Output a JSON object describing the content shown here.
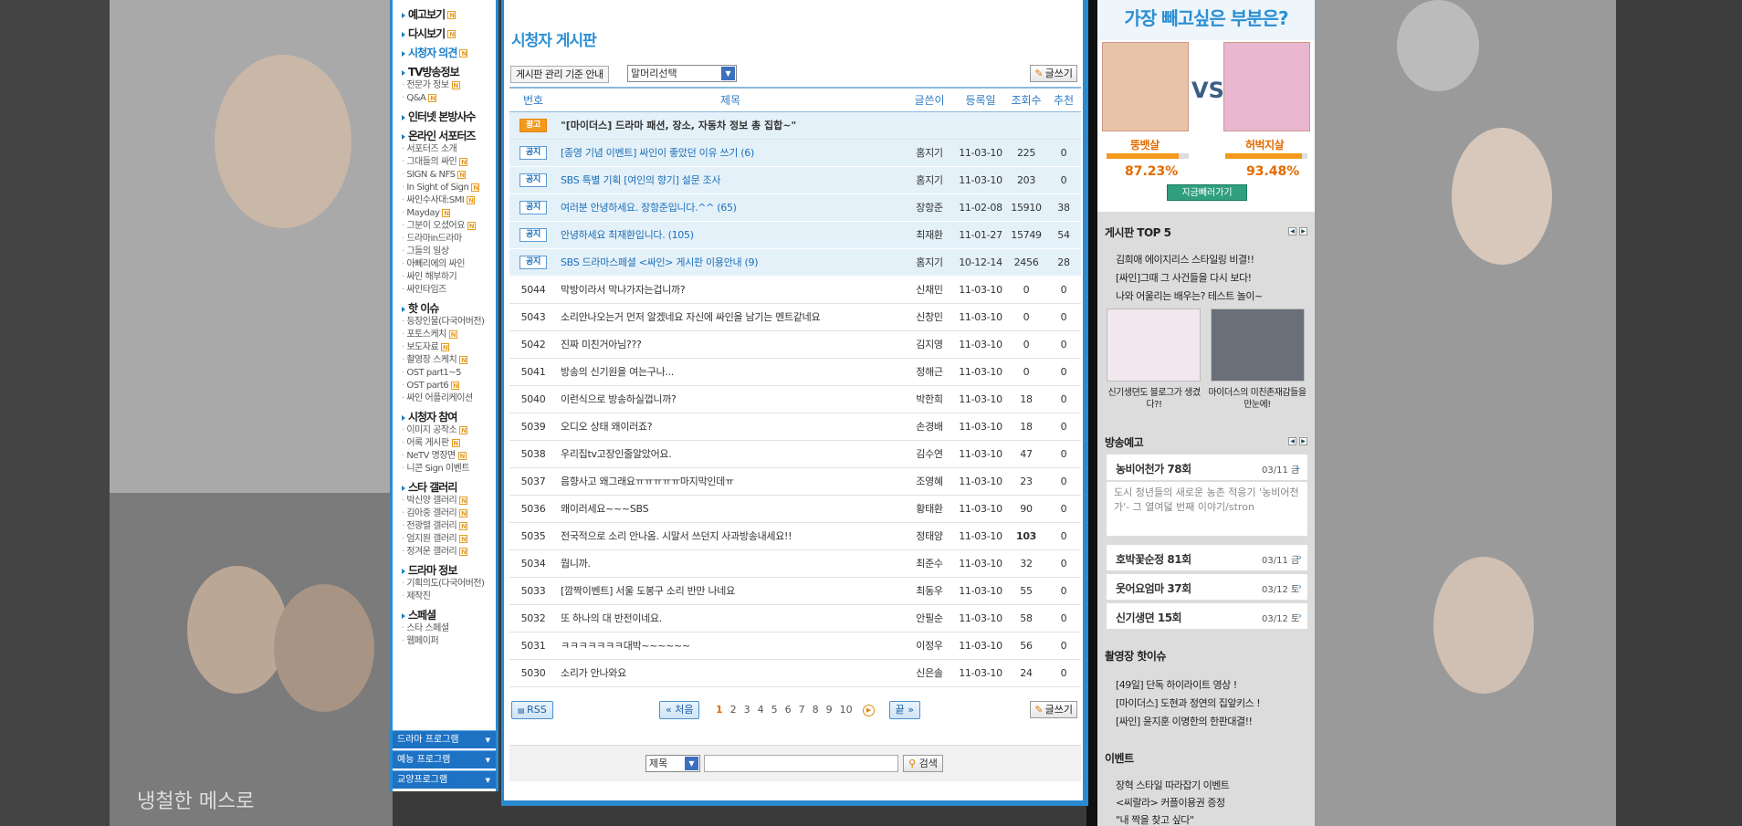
{
  "nav": {
    "sections": [
      {
        "title": "예고보기",
        "new": true,
        "blue": false,
        "items": []
      },
      {
        "title": "다시보기",
        "new": true,
        "blue": false,
        "items": []
      },
      {
        "title": "시청자 의견",
        "new": true,
        "blue": true,
        "items": []
      },
      {
        "title": "TV방송정보",
        "new": false,
        "blue": false,
        "items": [
          {
            "label": "전문가 정보",
            "new": true
          },
          {
            "label": "Q&A",
            "new": true
          }
        ]
      },
      {
        "title": "인터넷 본방사수",
        "new": false,
        "blue": false,
        "items": []
      },
      {
        "title": "온라인 서포터즈",
        "new": false,
        "blue": false,
        "items": [
          {
            "label": "서포터즈 소개",
            "new": false
          },
          {
            "label": "그대들의 싸인",
            "new": true
          },
          {
            "label": "SIGN & NFS",
            "new": true
          },
          {
            "label": "In Sight of Sign",
            "new": true
          },
          {
            "label": "싸인수사대:SMI",
            "new": true
          },
          {
            "label": "Mayday",
            "new": true
          },
          {
            "label": "그분이 오셨어요",
            "new": true
          },
          {
            "label": "드라마in드라마",
            "new": false
          },
          {
            "label": "그들의 일상",
            "new": false
          },
          {
            "label": "아뻬리에의 싸인",
            "new": false
          },
          {
            "label": "싸인 해부하기",
            "new": false
          },
          {
            "label": "싸인타임즈",
            "new": false
          }
        ]
      },
      {
        "title": "핫 이슈",
        "new": false,
        "blue": false,
        "items": [
          {
            "label": "등장인물(다국어버전)",
            "new": false
          },
          {
            "label": "포토스케치",
            "new": true
          },
          {
            "label": "보도자료",
            "new": true
          },
          {
            "label": "촬영장 스케치",
            "new": true
          },
          {
            "label": "OST part1~5",
            "new": false
          },
          {
            "label": "OST part6",
            "new": true
          },
          {
            "label": "싸인 어플리케이션",
            "new": false
          }
        ]
      },
      {
        "title": "시청자 참여",
        "new": false,
        "blue": false,
        "items": [
          {
            "label": "이미지 공작소",
            "new": true
          },
          {
            "label": "어록 게시판",
            "new": true
          },
          {
            "label": "NeTV 명장면",
            "new": true
          },
          {
            "label": "니콘 Sign 이벤트",
            "new": false
          }
        ]
      },
      {
        "title": "스타 갤러리",
        "new": false,
        "blue": false,
        "items": [
          {
            "label": "박신양 갤러리",
            "new": true
          },
          {
            "label": "김아중 갤러리",
            "new": true
          },
          {
            "label": "전광렬 갤러리",
            "new": true
          },
          {
            "label": "엄지원 갤러리",
            "new": true
          },
          {
            "label": "정겨운 갤러리",
            "new": true
          }
        ]
      },
      {
        "title": "드라마 정보",
        "new": false,
        "blue": false,
        "items": [
          {
            "label": "기획의도(다국어버전)",
            "new": false
          },
          {
            "label": "제작진",
            "new": false
          }
        ]
      },
      {
        "title": "스페셜",
        "new": false,
        "blue": false,
        "items": [
          {
            "label": "스타 스페셜",
            "new": false
          },
          {
            "label": "웹페이퍼",
            "new": false
          }
        ]
      }
    ],
    "programs": [
      "드라마 프로그램",
      "예능 프로그램",
      "교양프로그램"
    ],
    "new_badge": "N"
  },
  "board": {
    "title": "시청자 게시판",
    "guide_button": "게시판 관리 기준 안내",
    "filter_select": "말머리선택",
    "write_button": "글쓰기",
    "columns": [
      "번호",
      "제목",
      "글쓴이",
      "등록일",
      "조회수",
      "추천"
    ],
    "ad_row": {
      "badge": "광고",
      "subject": "\"[마이더스] 드라마 패션, 장소, 자동차 정보 총 집합~\""
    },
    "notices": [
      {
        "badge": "공지",
        "subject": "[종영 기념 이벤트] 싸인이 좋았던 이유 쓰기 (6)",
        "author": "홈지기",
        "date": "11-03-10",
        "views": "225",
        "rec": "0"
      },
      {
        "badge": "공지",
        "subject": "SBS 특별 기획 [여인의 향기] 설문 조사",
        "author": "홈지기",
        "date": "11-03-10",
        "views": "203",
        "rec": "0"
      },
      {
        "badge": "공지",
        "subject": "여러분 안녕하세요. 장항준입니다.^^ (65)",
        "author": "장항준",
        "date": "11-02-08",
        "views": "15910",
        "rec": "38"
      },
      {
        "badge": "공지",
        "subject": "안녕하세요 최재환입니다. (105)",
        "author": "최재환",
        "date": "11-01-27",
        "views": "15749",
        "rec": "54"
      },
      {
        "badge": "공지",
        "subject": "SBS 드라마스페셜 <싸인> 게시판 이용안내 (9)",
        "author": "홈지기",
        "date": "10-12-14",
        "views": "2456",
        "rec": "28"
      }
    ],
    "posts": [
      {
        "no": "5044",
        "subject": "막방이라서 막나가자는겁니까?",
        "author": "신채민",
        "date": "11-03-10",
        "views": "0",
        "rec": "0",
        "bold": false
      },
      {
        "no": "5043",
        "subject": "소리안나오는거 먼저 알겠네요 자신에 싸인을 남기는 멘트같네요",
        "author": "신창민",
        "date": "11-03-10",
        "views": "0",
        "rec": "0",
        "bold": false
      },
      {
        "no": "5042",
        "subject": "진짜 미친거아님???",
        "author": "김지영",
        "date": "11-03-10",
        "views": "0",
        "rec": "0",
        "bold": false
      },
      {
        "no": "5041",
        "subject": "방송의 신기원을 여는구나...",
        "author": "정해근",
        "date": "11-03-10",
        "views": "0",
        "rec": "0",
        "bold": false
      },
      {
        "no": "5040",
        "subject": "이런식으로 방송하실껍니까?",
        "author": "박한희",
        "date": "11-03-10",
        "views": "18",
        "rec": "0",
        "bold": false
      },
      {
        "no": "5039",
        "subject": "오디오 상태 왜이러죠?",
        "author": "손경배",
        "date": "11-03-10",
        "views": "18",
        "rec": "0",
        "bold": false
      },
      {
        "no": "5038",
        "subject": "우리집tv고장인줄알았어요.",
        "author": "김수연",
        "date": "11-03-10",
        "views": "47",
        "rec": "0",
        "bold": false
      },
      {
        "no": "5037",
        "subject": "음향사고 왜그래요ㅠㅠㅠㅠㅠ마지막인데ㅠ",
        "author": "조영혜",
        "date": "11-03-10",
        "views": "23",
        "rec": "0",
        "bold": false
      },
      {
        "no": "5036",
        "subject": "왜이러세요~~~SBS",
        "author": "황태환",
        "date": "11-03-10",
        "views": "90",
        "rec": "0",
        "bold": false
      },
      {
        "no": "5035",
        "subject": "전국적으로 소리 안나옴. 시말서 쓰던지 사과방송내세요!!",
        "author": "정태양",
        "date": "11-03-10",
        "views": "103",
        "rec": "0",
        "bold": true
      },
      {
        "no": "5034",
        "subject": "뭡니까.",
        "author": "최준수",
        "date": "11-03-10",
        "views": "32",
        "rec": "0",
        "bold": false
      },
      {
        "no": "5033",
        "subject": "[깜짝이벤트] 서울 도봉구 소리 반만 나네요",
        "author": "최동우",
        "date": "11-03-10",
        "views": "55",
        "rec": "0",
        "bold": false
      },
      {
        "no": "5032",
        "subject": "또 하나의 대 반전이네요.",
        "author": "안필순",
        "date": "11-03-10",
        "views": "58",
        "rec": "0",
        "bold": false
      },
      {
        "no": "5031",
        "subject": "ㅋㅋㅋㅋㅋㅋㅋ대박~~~~~~",
        "author": "이정우",
        "date": "11-03-10",
        "views": "56",
        "rec": "0",
        "bold": false
      },
      {
        "no": "5030",
        "subject": "소리가 안나와요",
        "author": "신은솔",
        "date": "11-03-10",
        "views": "24",
        "rec": "0",
        "bold": false
      }
    ],
    "rss": "RSS",
    "pagination": {
      "first": "« 처음",
      "pages": [
        "1",
        "2",
        "3",
        "4",
        "5",
        "6",
        "7",
        "8",
        "9",
        "10"
      ],
      "current": "1",
      "last": "끝 »"
    },
    "search": {
      "field": "제목",
      "button": "검색"
    }
  },
  "side": {
    "poll": {
      "question": "가장 빼고싶은 부분은?",
      "vs": "VS",
      "left": {
        "label": "뚱뱃살",
        "pct": "87.23%",
        "value": 0.8723
      },
      "right": {
        "label": "허벅지살",
        "pct": "93.48%",
        "value": 0.9348
      },
      "vote": "지금빼러가기"
    },
    "top5": {
      "title": "게시판 TOP 5",
      "items": [
        "김희애 에이지리스 스타일링 비결!!",
        "[싸인]그때 그 사건들을 다시 보다!",
        "나와 어울리는 배우는? 테스트 놀이~"
      ],
      "thumbs": [
        "신기생뎐도 블로그가 생겼다?!",
        "마이더스의 미친존재감들을 만눈에!"
      ]
    },
    "preview": {
      "title": "방송예고",
      "items": [
        {
          "name": "농비어천가 78회",
          "date": "03/11 금"
        },
        {
          "name": "호박꽃순정 81회",
          "date": "03/11 금"
        },
        {
          "name": "웃어요엄마 37회",
          "date": "03/12 토"
        },
        {
          "name": "신기생뎐 15회",
          "date": "03/12 토"
        }
      ],
      "desc": "도시 청년들의 새로운 농촌 적응기 '농비어천가'- 그 열여덟 번째 이야기/stron"
    },
    "hot": {
      "title": "촬영장 핫이슈",
      "items": [
        "[49일] 단독 하이라이트 영상 !",
        "[마이더스] 도현과 정연의 집앞키스 !",
        "[싸인] 윤지훈 이명한의 한판대결!!"
      ]
    },
    "event": {
      "title": "이벤트",
      "items": [
        "장혁 스타일 따라잡기 이벤트",
        "<씨랄라> 커플이용권 증정",
        "\"내 짝을 찾고 싶다\""
      ]
    }
  },
  "background": {
    "caption": "냉철한 메스로"
  }
}
